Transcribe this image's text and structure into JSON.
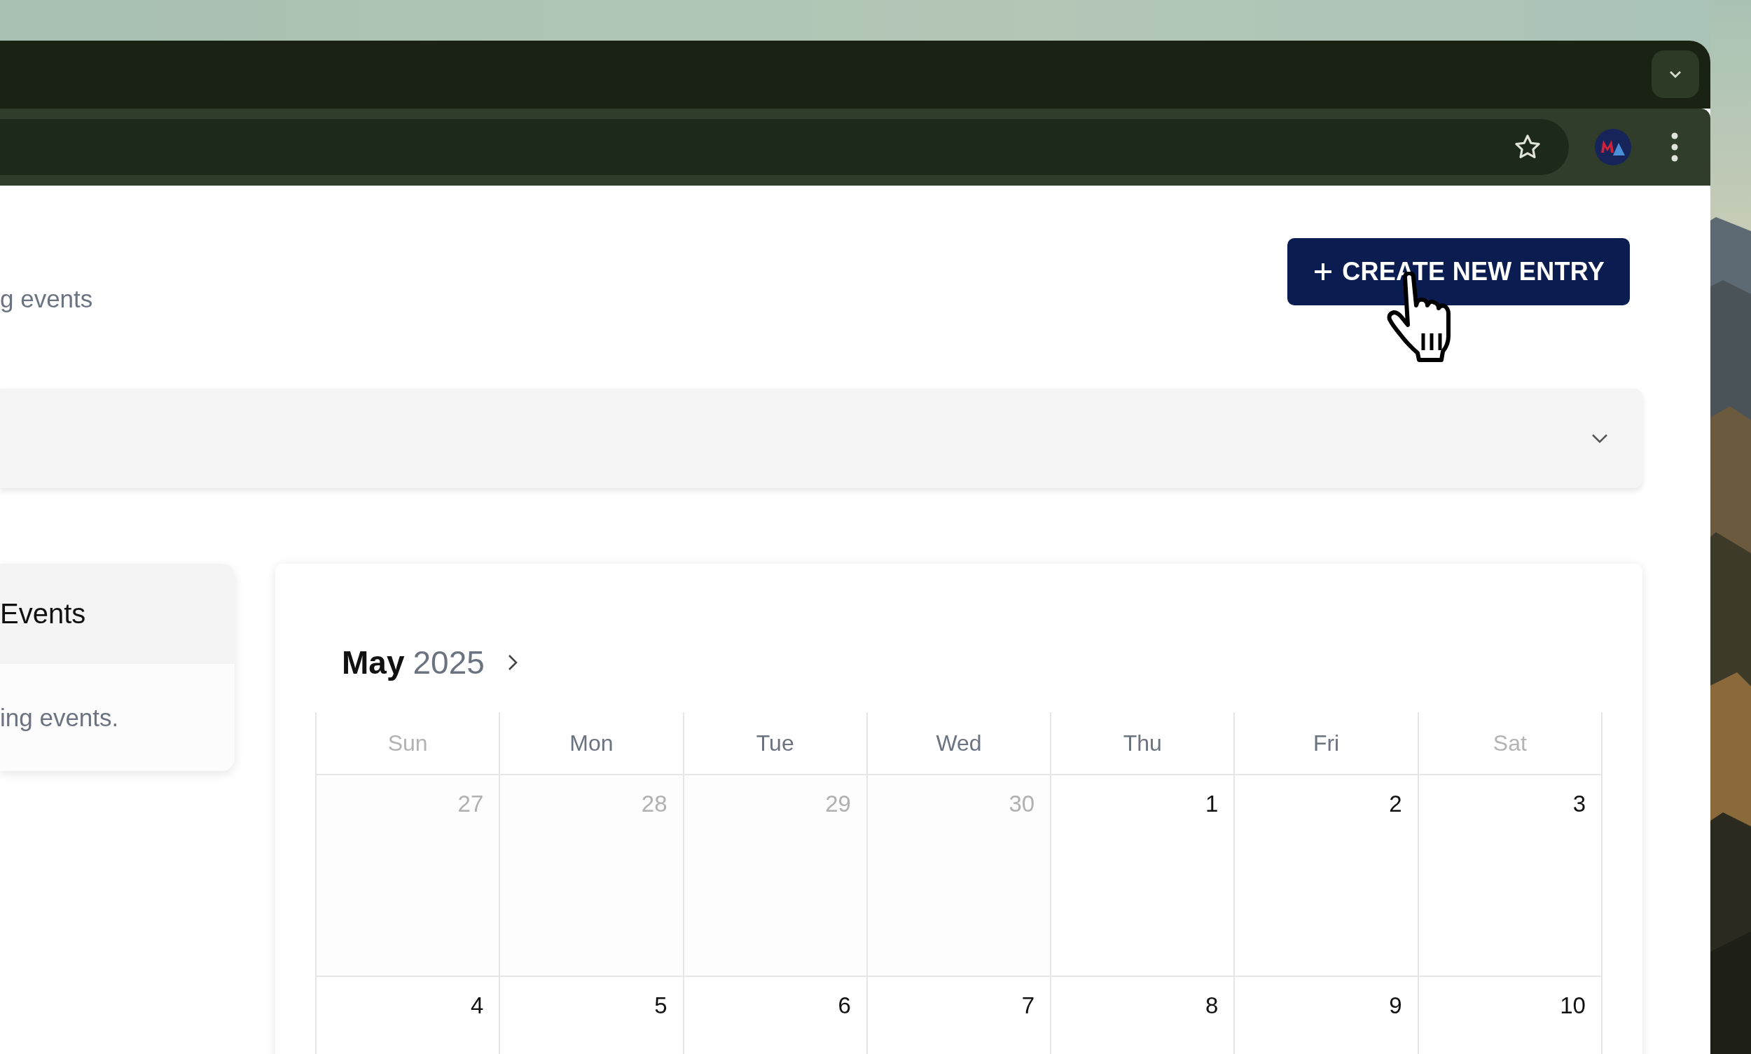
{
  "header": {
    "subtitle": "g events",
    "create_button": "CREATE NEW ENTRY"
  },
  "filter_bar": {
    "expanded": false
  },
  "events_panel": {
    "title": "Events",
    "message": "ing events."
  },
  "calendar": {
    "month": "May",
    "year": "2025",
    "weekdays": [
      {
        "label": "Sun",
        "weekend": true
      },
      {
        "label": "Mon",
        "weekend": false
      },
      {
        "label": "Tue",
        "weekend": false
      },
      {
        "label": "Wed",
        "weekend": false
      },
      {
        "label": "Thu",
        "weekend": false
      },
      {
        "label": "Fri",
        "weekend": false
      },
      {
        "label": "Sat",
        "weekend": true
      }
    ],
    "weeks": [
      [
        {
          "day": "27",
          "outside": true
        },
        {
          "day": "28",
          "outside": true
        },
        {
          "day": "29",
          "outside": true
        },
        {
          "day": "30",
          "outside": true
        },
        {
          "day": "1",
          "outside": false
        },
        {
          "day": "2",
          "outside": false
        },
        {
          "day": "3",
          "outside": false
        }
      ],
      [
        {
          "day": "4",
          "outside": false
        },
        {
          "day": "5",
          "outside": false
        },
        {
          "day": "6",
          "outside": false
        },
        {
          "day": "7",
          "outside": false
        },
        {
          "day": "8",
          "outside": false
        },
        {
          "day": "9",
          "outside": false
        },
        {
          "day": "10",
          "outside": false
        }
      ]
    ]
  }
}
